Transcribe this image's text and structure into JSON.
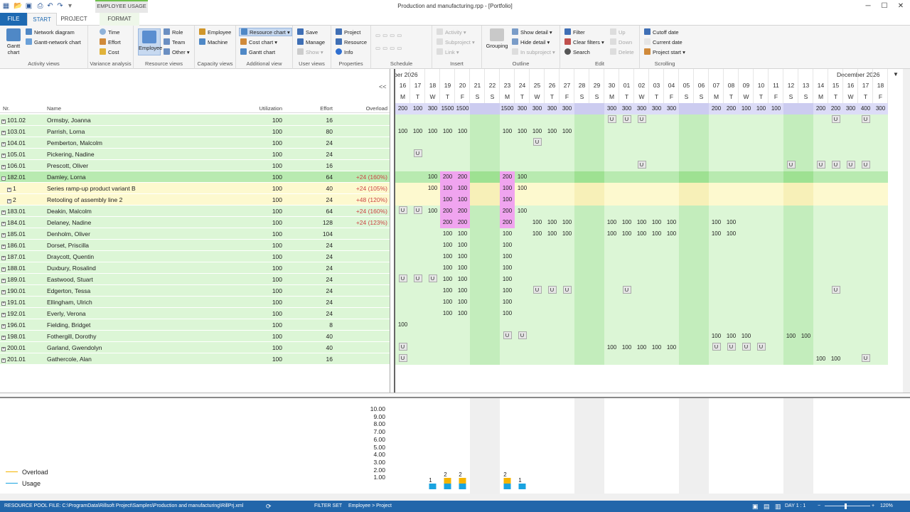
{
  "window": {
    "title": "Production and manufacturing.rpp - [Portfolio]",
    "context_tab": "EMPLOYEE USAGE",
    "minimize": "─",
    "maximize": "☐",
    "close": "✕"
  },
  "tabs": {
    "file": "FILE",
    "start": "START",
    "project": "PROJECT",
    "format": "FORMAT"
  },
  "ribbon": {
    "activity_views": {
      "label": "Activity views",
      "gantt": "Gantt chart",
      "network": "Network diagram",
      "gantt_network": "Gantt-network chart"
    },
    "variance": {
      "label": "Variance analysis",
      "time": "Time",
      "effort": "Effort",
      "cost": "Cost"
    },
    "resource_views": {
      "label": "Resource views",
      "employee": "Employee",
      "role": "Role",
      "team": "Team",
      "other": "Other"
    },
    "capacity_views": {
      "label": "Capacity views",
      "employee": "Employee",
      "machine": "Machine"
    },
    "additional": {
      "label": "Additional view",
      "resource_chart": "Resource chart",
      "cost_chart": "Cost chart",
      "gantt_chart": "Gantt chart"
    },
    "user_views": {
      "label": "User views",
      "save": "Save",
      "manage": "Manage",
      "show": "Show"
    },
    "properties": {
      "label": "Properties",
      "project": "Project",
      "resource": "Resource",
      "info": "Info"
    },
    "schedule": {
      "label": "Schedule"
    },
    "insert": {
      "label": "Insert",
      "activity": "Activity",
      "subproject": "Subproject",
      "link": "Link"
    },
    "outline": {
      "label": "Outline",
      "grouping": "Grouping",
      "show_detail": "Show detail",
      "hide_detail": "Hide detail",
      "in_subproject": "In subproject"
    },
    "edit": {
      "label": "Edit",
      "filter": "Filter",
      "clear_filters": "Clear filters",
      "search": "Search",
      "up": "Up",
      "down": "Down",
      "delete": "Delete"
    },
    "scrolling": {
      "label": "Scrolling",
      "cutoff": "Cutoff date",
      "current": "Current date",
      "project_start": "Project start"
    }
  },
  "table": {
    "collapse": "<<",
    "headers": {
      "nr": "Nr.",
      "name": "Name",
      "utilization": "Utilization",
      "effort": "Effort",
      "overload": "Overload"
    },
    "rows": [
      {
        "nr": "101.02",
        "name": "Ormsby, Joanna",
        "util": "100",
        "effort": "16",
        "overload": ""
      },
      {
        "nr": "103.01",
        "name": "Parrish, Lorna",
        "util": "100",
        "effort": "80",
        "overload": ""
      },
      {
        "nr": "104.01",
        "name": "Pemberton, Malcolm",
        "util": "100",
        "effort": "24",
        "overload": ""
      },
      {
        "nr": "105.01",
        "name": "Pickering, Nadine",
        "util": "100",
        "effort": "24",
        "overload": ""
      },
      {
        "nr": "106.01",
        "name": "Prescott, Oliver",
        "util": "100",
        "effort": "16",
        "overload": ""
      },
      {
        "nr": "182.01",
        "name": "Damley, Lorna",
        "util": "100",
        "effort": "64",
        "overload": "+24 (160%)"
      },
      {
        "nr": "1",
        "name": "Series ramp-up product variant B",
        "util": "100",
        "effort": "40",
        "overload": "+24 (105%)"
      },
      {
        "nr": "2",
        "name": "Retooling of assembly line 2",
        "util": "100",
        "effort": "24",
        "overload": "+48 (120%)"
      },
      {
        "nr": "183.01",
        "name": "Deakin, Malcolm",
        "util": "100",
        "effort": "64",
        "overload": "+24 (160%)"
      },
      {
        "nr": "184.01",
        "name": "Delaney, Nadine",
        "util": "100",
        "effort": "128",
        "overload": "+24 (123%)"
      },
      {
        "nr": "185.01",
        "name": "Denholm, Oliver",
        "util": "100",
        "effort": "104",
        "overload": ""
      },
      {
        "nr": "186.01",
        "name": "Dorset, Priscilla",
        "util": "100",
        "effort": "24",
        "overload": ""
      },
      {
        "nr": "187.01",
        "name": "Draycott, Quentin",
        "util": "100",
        "effort": "24",
        "overload": ""
      },
      {
        "nr": "188.01",
        "name": "Duxbury, Rosalind",
        "util": "100",
        "effort": "24",
        "overload": ""
      },
      {
        "nr": "189.01",
        "name": "Eastwood, Stuart",
        "util": "100",
        "effort": "24",
        "overload": ""
      },
      {
        "nr": "190.01",
        "name": "Edgerton, Tessa",
        "util": "100",
        "effort": "24",
        "overload": ""
      },
      {
        "nr": "191.01",
        "name": "Ellingham, Ulrich",
        "util": "100",
        "effort": "24",
        "overload": ""
      },
      {
        "nr": "192.01",
        "name": "Everly, Verona",
        "util": "100",
        "effort": "24",
        "overload": ""
      },
      {
        "nr": "196.01",
        "name": "Fielding, Bridget",
        "util": "100",
        "effort": "8",
        "overload": ""
      },
      {
        "nr": "198.01",
        "name": "Fothergill, Dorothy",
        "util": "100",
        "effort": "40",
        "overload": ""
      },
      {
        "nr": "200.01",
        "name": "Garland, Gwendolyn",
        "util": "100",
        "effort": "40",
        "overload": ""
      },
      {
        "nr": "201.01",
        "name": "Gathercole, Alan",
        "util": "100",
        "effort": "16",
        "overload": ""
      }
    ]
  },
  "timeline": {
    "month_left": "ber 2026",
    "month_right": "December 2026",
    "days": [
      "16",
      "17",
      "18",
      "19",
      "20",
      "21",
      "22",
      "23",
      "24",
      "25",
      "26",
      "27",
      "28",
      "29",
      "30",
      "01",
      "02",
      "03",
      "04",
      "05",
      "06",
      "07",
      "08",
      "09",
      "10",
      "11",
      "12",
      "13",
      "14",
      "15",
      "16",
      "17",
      "18"
    ],
    "weekdays": [
      "M",
      "T",
      "W",
      "T",
      "F",
      "S",
      "S",
      "M",
      "T",
      "W",
      "T",
      "F",
      "S",
      "S",
      "M",
      "T",
      "W",
      "T",
      "F",
      "S",
      "S",
      "M",
      "T",
      "W",
      "T",
      "F",
      "S",
      "S",
      "M",
      "T",
      "W",
      "T",
      "F"
    ],
    "summary": [
      "200",
      "100",
      "300",
      "1500",
      "1500",
      "",
      "",
      "1500",
      "300",
      "300",
      "300",
      "300",
      "",
      "",
      "300",
      "300",
      "300",
      "300",
      "300",
      "",
      "",
      "200",
      "200",
      "100",
      "100",
      "100",
      "",
      "",
      "200",
      "200",
      "300",
      "400",
      "300"
    ],
    "cells": [
      "..............UUU............U.U",
      "100,100,100,100,100,,,100,100,100,100,100,,,,,,,,,,,,,,,,,,,,,",
      ".........U......................",
      ".U..............................",
      "................U.........U.UUUU",
      "..100,200,200,,,200,100,,,,,,,,,,,,,,,,,,,,,,,,",
      "..100,100,100,,,100,100,,,,,,,,,,,,,,,,,,,,,,,,",
      "...100,100,,,100,,,,,,,,,,,,,,,,,,,,,,,,",
      "UU100,200,200,,,200,100,,,,,,,,,,,,,,,,,,,,,,,,",
      "...200,200,,,200,,100,100,100,,,100,100,100,100,100,,,100,100,,,,,,,,,,",
      "...100,100,,,100,,100,100,100,,,100,100,100,100,100,,,100,100,,,,,,,,,,",
      "...100,100,,,100,,,,,,,,,,,,,,,,,,,,,,,,",
      "...100,100,,,100,,,,,,,,,,,,,,,,,,,,,,,,",
      "...100,100,,,100,,,,,,,,,,,,,,,,,,,,,,,,",
      "UUU100,100,,,100,,,,,,,,,,,,,,,,,,,,,,,,",
      "...100,100,,,100,,UUU,,,U,,,,,,,,,,,,,U,,,,",
      "...100,100,,,100,,,,,,,,,,,,,,,,,,,,,,,,",
      "...100,100,,,100,,,,,,,,,,,,,,,,,,,,,,,,",
      "100,,,,,,,,,,,,,,,,,,,,,,,,,,,,,,,,",
      ".......UU............100,100,100,,,100,100,,,,",
      "U.............100,100,100,100,100,,,UUUU,,,,,,,",
      "U...........................100,100,,U"
    ]
  },
  "chart": {
    "legend_overload": "Overload",
    "legend_usage": "Usage",
    "legend_colors": {
      "overload": "#f5b400",
      "usage": "#1aa3e0"
    },
    "yticks": [
      "10.00",
      "9.00",
      "8.00",
      "7.00",
      "6.00",
      "5.00",
      "4.00",
      "3.00",
      "2.00",
      "1.00"
    ],
    "chart_data": {
      "type": "bar",
      "x": [
        "16",
        "17",
        "18",
        "19",
        "20",
        "21",
        "22",
        "23",
        "24"
      ],
      "series": [
        {
          "name": "Usage",
          "values": [
            0,
            0,
            1,
            1,
            1,
            0,
            0,
            1,
            1
          ]
        },
        {
          "name": "Overload",
          "values": [
            0,
            0,
            0,
            1,
            1,
            0,
            0,
            1,
            0
          ]
        }
      ],
      "data_labels": [
        "",
        "",
        "1",
        "2",
        "2",
        "",
        "",
        "2",
        "1"
      ],
      "ylim": [
        0,
        10
      ]
    }
  },
  "status": {
    "pool_file": "RESOURCE POOL FILE: C:\\ProgramData\\Rillsoft Project\\Samples\\Production and manufacturing\\RillPrj.xml",
    "filter_set": "FILTER SET",
    "filter_value": "Employee > Project",
    "day": "DAY 1 : 1",
    "zoom": "120%"
  }
}
